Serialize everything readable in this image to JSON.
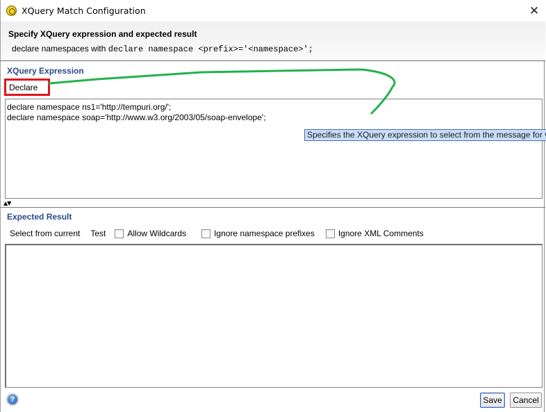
{
  "window": {
    "title": "XQuery Match Configuration",
    "app_icon": "soapui-icon",
    "close_icon": "close-icon"
  },
  "header": {
    "title": "Specify XQuery expression and expected result",
    "desc_prefix": "declare namespaces with ",
    "desc_code": "declare namespace <prefix>='<namespace>';"
  },
  "xquery": {
    "section_title": "XQuery Expression",
    "declare_label": "Declare",
    "expression_lines": [
      "declare namespace ns1='http://tempuri.org/';",
      "declare namespace soap='http://www.w3.org/2003/05/soap-envelope';"
    ],
    "tooltip": "Specifies the XQuery expression to select from the message for validation"
  },
  "splitter": {
    "up_icon": "▲",
    "down_icon": "▼"
  },
  "expected": {
    "section_title": "Expected Result",
    "select_from_current": "Select from current",
    "test": "Test",
    "options": [
      {
        "label": "Allow Wildcards",
        "checked": false
      },
      {
        "label": "Ignore namespace prefixes",
        "checked": false
      },
      {
        "label": "Ignore XML Comments",
        "checked": false
      }
    ],
    "result_value": ""
  },
  "footer": {
    "help_label": "?",
    "save_label": "Save",
    "cancel_label": "Cancel"
  },
  "annotation_color": "#22b14c",
  "highlight_color": "#e0141c"
}
